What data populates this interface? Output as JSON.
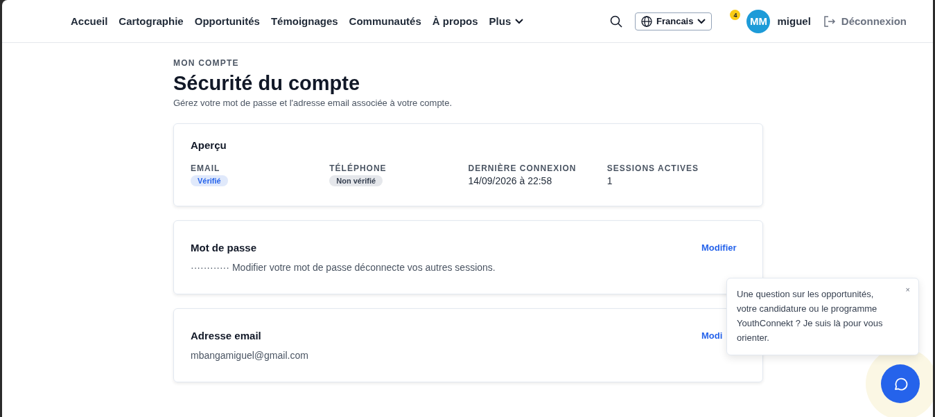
{
  "nav": {
    "links": [
      {
        "label": "Accueil"
      },
      {
        "label": "Cartographie"
      },
      {
        "label": "Opportunités"
      },
      {
        "label": "Témoignages"
      },
      {
        "label": "Communautés"
      },
      {
        "label": "À propos"
      },
      {
        "label": "Plus",
        "dropdown": true
      }
    ],
    "language": "Francais",
    "notifications": "4",
    "avatar": "MM",
    "username": "miguel",
    "logout": "Déconnexion"
  },
  "header": {
    "eyebrow": "MON COMPTE",
    "title": "Sécurité du compte",
    "subtitle": "Gérez votre mot de passe et l'adresse email associée à votre compte."
  },
  "overview": {
    "title": "Aperçu",
    "items": [
      {
        "label": "EMAIL",
        "kind": "badge",
        "value": "Vérifié",
        "verified": true
      },
      {
        "label": "TÉLÉPHONE",
        "kind": "badge",
        "value": "Non vérifié",
        "verified": false
      },
      {
        "label": "DERNIÈRE CONNEXION",
        "kind": "text",
        "value": "14/09/2026 à 22:58"
      },
      {
        "label": "SESSIONS ACTIVES",
        "kind": "text",
        "value": "1"
      }
    ]
  },
  "sections": [
    {
      "title": "Mot de passe",
      "action": "Modifier",
      "mask": "············",
      "text": "Modifier votre mot de passe déconnecte vos autres sessions."
    },
    {
      "title": "Adresse email",
      "action": "Modi",
      "text": "mbangamiguel@gmail.com"
    }
  ],
  "chat": {
    "message": "Une question sur les opportunités, votre candidature ou le programme YouthConnekt ? Je suis là pour vous orienter.",
    "close": "×"
  }
}
